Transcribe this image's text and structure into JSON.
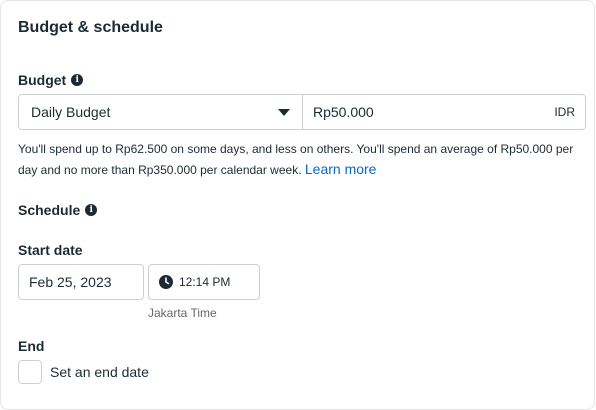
{
  "section_title": "Budget & schedule",
  "budget": {
    "label": "Budget",
    "type_selected": "Daily Budget",
    "amount_value": "Rp50.000",
    "currency": "IDR"
  },
  "help_text": {
    "line": "You'll spend up to Rp62.500 on some days, and less on others. You'll spend an average of Rp50.000 per day and no more than Rp350.000 per calendar week.",
    "learn_more": "Learn more"
  },
  "schedule": {
    "label": "Schedule",
    "start_date_label": "Start date",
    "start_date": "Feb 25, 2023",
    "start_time": "12:14 PM",
    "timezone": "Jakarta Time",
    "end_label": "End",
    "end_date_checkbox_label": "Set an end date",
    "end_date_checked": false
  },
  "icons": {
    "info": "info-icon",
    "clock": "clock-icon",
    "dropdown": "chevron-down-icon"
  },
  "colors": {
    "text": "#1c2b33",
    "link": "#0a66c2",
    "border": "#ccd0d5",
    "muted": "#65676b"
  }
}
